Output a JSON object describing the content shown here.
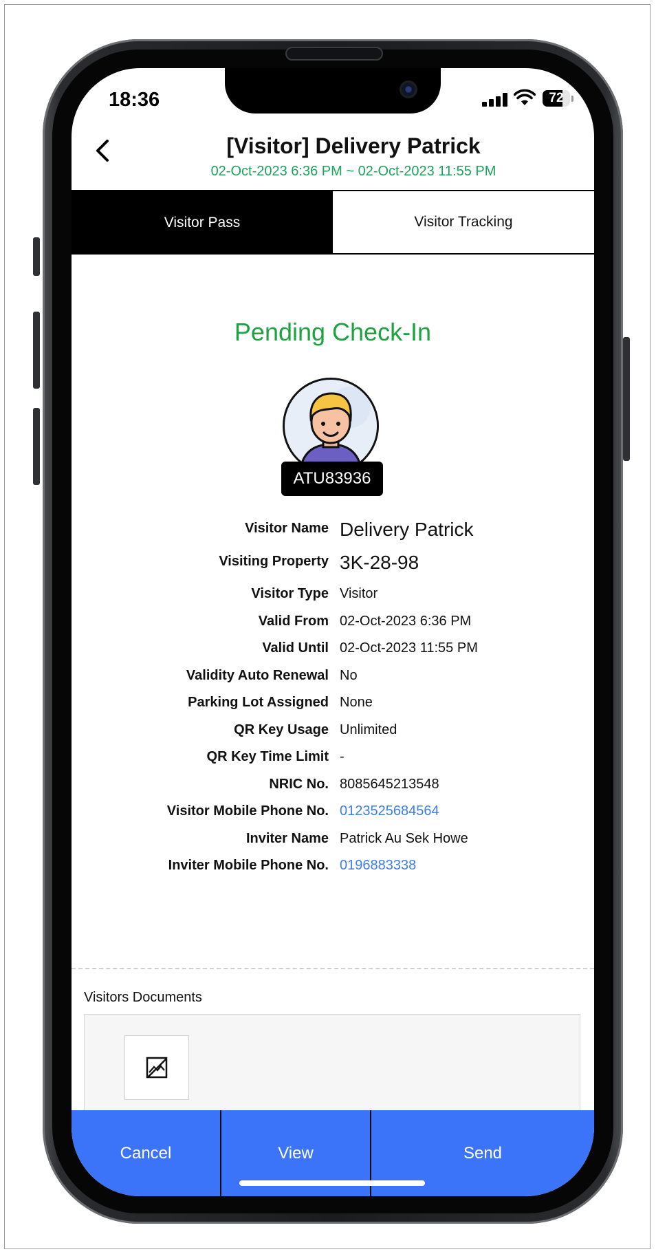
{
  "status_bar": {
    "time": "18:36",
    "battery": "72"
  },
  "header": {
    "title": "[Visitor] Delivery Patrick",
    "subtitle": "02-Oct-2023 6:36 PM ~ 02-Oct-2023 11:55 PM"
  },
  "tabs": [
    {
      "label": "Visitor Pass",
      "active": true
    },
    {
      "label": "Visitor Tracking",
      "active": false
    }
  ],
  "pass": {
    "status": "Pending Check-In",
    "visitor_id": "ATU83936"
  },
  "details": [
    {
      "label": "Visitor Name",
      "value": "Delivery Patrick"
    },
    {
      "label": "Visiting Property",
      "value": "3K-28-98"
    },
    {
      "label": "Visitor Type",
      "value": "Visitor"
    },
    {
      "label": "Valid From",
      "value": "02-Oct-2023 6:36 PM"
    },
    {
      "label": "Valid Until",
      "value": "02-Oct-2023 11:55 PM"
    },
    {
      "label": "Validity Auto Renewal",
      "value": "No"
    },
    {
      "label": "Parking Lot Assigned",
      "value": "None"
    },
    {
      "label": "QR Key Usage",
      "value": "Unlimited"
    },
    {
      "label": "QR Key Time Limit",
      "value": "-"
    },
    {
      "label": "NRIC No.",
      "value": "8085645213548"
    },
    {
      "label": "Visitor Mobile Phone No.",
      "value": "0123525684564"
    },
    {
      "label": "Inviter Name",
      "value": "Patrick Au Sek Howe"
    },
    {
      "label": "Inviter Mobile Phone No.",
      "value": "0196883338"
    }
  ],
  "documents": {
    "label": "Visitors Documents"
  },
  "actions": {
    "cancel": "Cancel",
    "view": "View",
    "send": "Send"
  },
  "colors": {
    "accent": "#3b74f8",
    "status_green": "#1aa33f",
    "link_blue": "#3b7de9",
    "subtitle_green": "#1aa35a"
  },
  "icons": {
    "back": "chevron-left-icon",
    "doc_placeholder": "broken-image-icon"
  }
}
